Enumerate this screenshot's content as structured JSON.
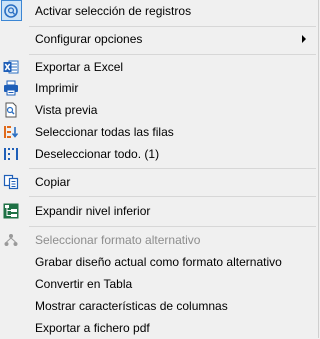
{
  "menu": {
    "items": [
      {
        "label": "Activar selección de registros"
      },
      {
        "label": "Configurar opciones"
      },
      {
        "label": "Exportar a Excel"
      },
      {
        "label": "Imprimir"
      },
      {
        "label": "Vista previa"
      },
      {
        "label": "Seleccionar todas las filas"
      },
      {
        "label": "Deseleccionar todo. (1)"
      },
      {
        "label": "Copiar"
      },
      {
        "label": "Expandir nivel inferior"
      },
      {
        "label": "Seleccionar formato alternativo",
        "disabled": true
      },
      {
        "label": "Grabar diseño actual como formato alternativo"
      },
      {
        "label": "Convertir en Tabla"
      },
      {
        "label": "Mostrar características de columnas"
      },
      {
        "label": "Exportar a fichero pdf"
      }
    ]
  },
  "icons": {
    "select_records": "magnifier-selection-icon",
    "configure": "submenu-arrow-icon",
    "excel": "excel-icon",
    "print": "printer-icon",
    "preview": "print-preview-icon",
    "select_all": "select-all-rows-icon",
    "deselect_all": "deselect-all-icon",
    "copy": "copy-icon",
    "expand": "expand-level-icon",
    "alt_format": "alt-format-icon"
  },
  "colors": {
    "accent": "#2b6fc2",
    "highlight_border": "#3b86d4",
    "highlight_fill": "#cce3f7",
    "excel_green": "#1e7145",
    "orange": "#e06a1b",
    "disabled": "#8d8d8d"
  }
}
